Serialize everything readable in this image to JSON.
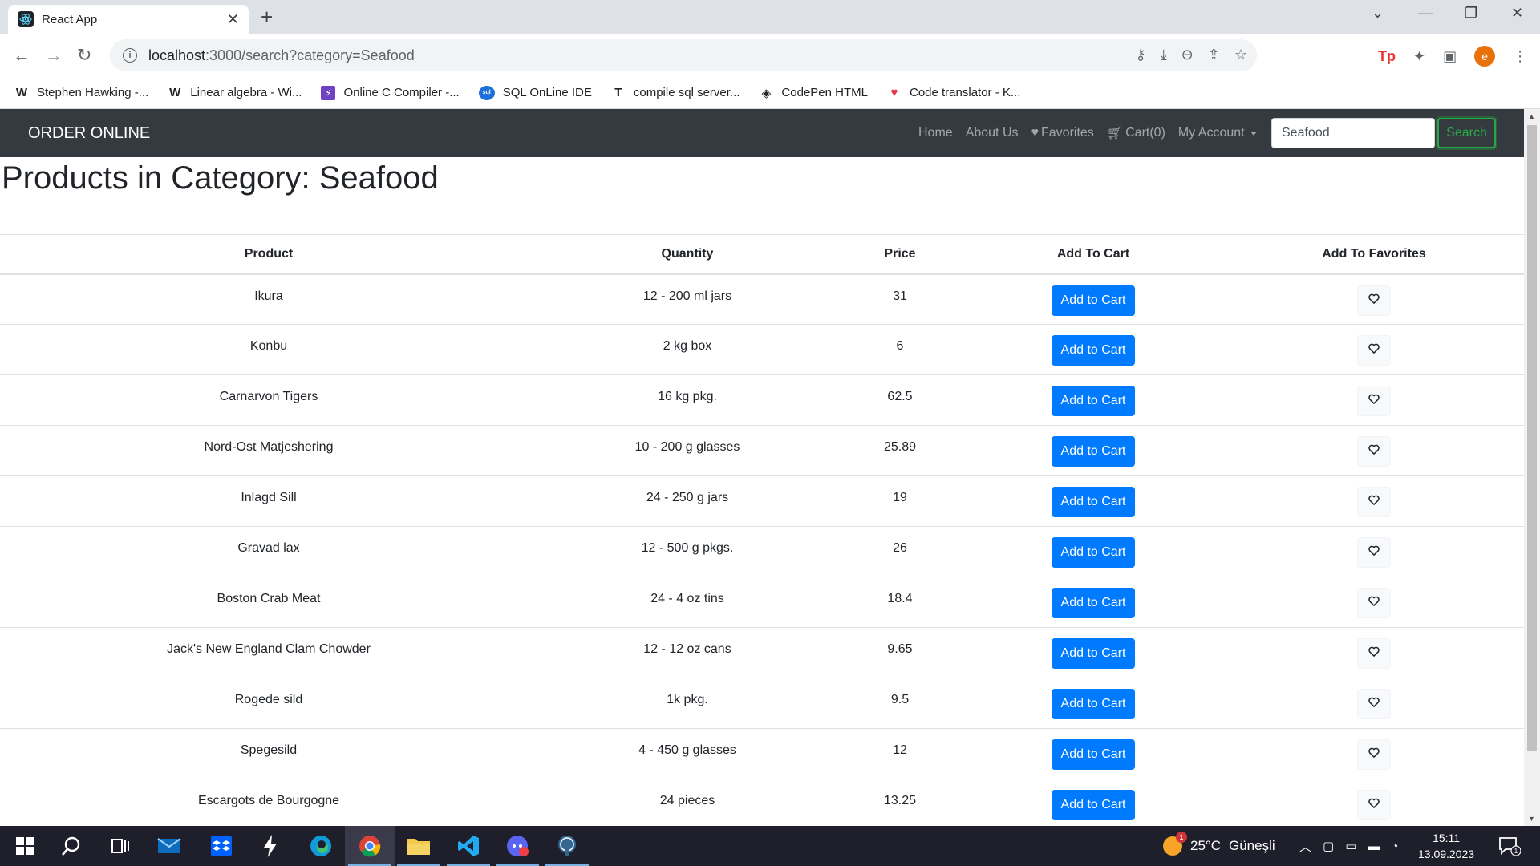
{
  "browser": {
    "tab_title": "React App",
    "url_host": "localhost",
    "url_rest": ":3000/search?category=Seafood",
    "bookmarks": [
      {
        "icon": "W",
        "label": "Stephen Hawking -..."
      },
      {
        "icon": "W",
        "label": "Linear algebra - Wi..."
      },
      {
        "icon": "⚡",
        "label": "Online C Compiler -..."
      },
      {
        "icon": "sql",
        "label": "SQL OnLine IDE"
      },
      {
        "icon": "T",
        "label": "compile sql server..."
      },
      {
        "icon": "◈",
        "label": "CodePen HTML"
      },
      {
        "icon": "♥",
        "label": "Code translator - K..."
      }
    ],
    "profile_initial": "e"
  },
  "navbar": {
    "brand": "ORDER ONLINE",
    "home": "Home",
    "about": "About Us",
    "favorites": "Favorites",
    "cart": "Cart(0)",
    "account": "My Account",
    "search_value": "Seafood",
    "search_button": "Search"
  },
  "page": {
    "title": "Products in Category: Seafood",
    "columns": [
      "Product",
      "Quantity",
      "Price",
      "Add To Cart",
      "Add To Favorites"
    ],
    "add_label": "Add to Cart",
    "products": [
      {
        "name": "Ikura",
        "quantity": "12 - 200 ml jars",
        "price": "31"
      },
      {
        "name": "Konbu",
        "quantity": "2 kg box",
        "price": "6"
      },
      {
        "name": "Carnarvon Tigers",
        "quantity": "16 kg pkg.",
        "price": "62.5"
      },
      {
        "name": "Nord-Ost Matjeshering",
        "quantity": "10 - 200 g glasses",
        "price": "25.89"
      },
      {
        "name": "Inlagd Sill",
        "quantity": "24 - 250 g jars",
        "price": "19"
      },
      {
        "name": "Gravad lax",
        "quantity": "12 - 500 g pkgs.",
        "price": "26"
      },
      {
        "name": "Boston Crab Meat",
        "quantity": "24 - 4 oz tins",
        "price": "18.4"
      },
      {
        "name": "Jack's New England Clam Chowder",
        "quantity": "12 - 12 oz cans",
        "price": "9.65"
      },
      {
        "name": "Rogede sild",
        "quantity": "1k pkg.",
        "price": "9.5"
      },
      {
        "name": "Spegesild",
        "quantity": "4 - 450 g glasses",
        "price": "12"
      },
      {
        "name": "Escargots de Bourgogne",
        "quantity": "24 pieces",
        "price": "13.25"
      }
    ]
  },
  "taskbar": {
    "weather_temp": "25°C",
    "weather_text": "Güneşli",
    "weather_badge": "1",
    "time": "15:11",
    "date": "13.09.2023",
    "notif_count": "1"
  },
  "colors": {
    "navbar_bg": "#343a40",
    "primary": "#007bff",
    "success": "#28a745"
  }
}
